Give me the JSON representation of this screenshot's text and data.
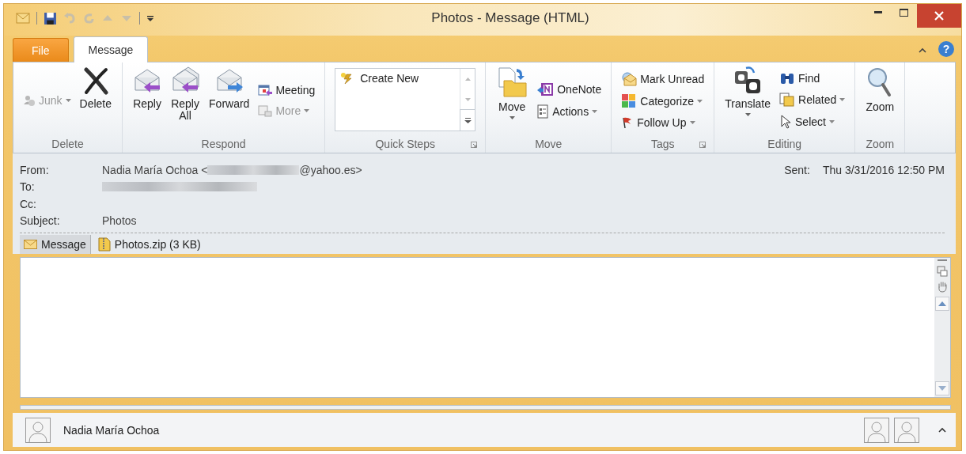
{
  "window": {
    "title": "Photos - Message (HTML)"
  },
  "tabs": [
    {
      "label": "File",
      "selected": false,
      "kind": "file"
    },
    {
      "label": "Message",
      "selected": true,
      "kind": "tab"
    }
  ],
  "help": "?",
  "ribbon_groups": [
    {
      "label": "Delete",
      "items": [
        {
          "kind": "column",
          "buttons": [
            {
              "label": "Junk",
              "disabled": true,
              "dropdown": true
            }
          ]
        },
        {
          "kind": "large",
          "label": "Delete",
          "disabled": false,
          "dropdown": false
        }
      ]
    },
    {
      "label": "Respond",
      "items": [
        {
          "kind": "large",
          "label": "Reply",
          "disabled": false,
          "dropdown": false
        },
        {
          "kind": "large",
          "label": "Reply\nAll",
          "disabled": false,
          "dropdown": false
        },
        {
          "kind": "large",
          "label": "Forward",
          "disabled": false,
          "dropdown": false
        },
        {
          "kind": "column",
          "buttons": [
            {
              "label": "Meeting",
              "disabled": false,
              "dropdown": false
            },
            {
              "label": "More",
              "disabled": true,
              "dropdown": true
            }
          ]
        }
      ]
    },
    {
      "label": "Quick Steps",
      "launcher": true,
      "items": [
        {
          "kind": "gallery",
          "entries": [
            "Create New"
          ]
        }
      ]
    },
    {
      "label": "Move",
      "items": [
        {
          "kind": "large",
          "label": "Move",
          "disabled": false,
          "dropdown": true
        },
        {
          "kind": "column",
          "buttons": [
            {
              "label": "OneNote",
              "disabled": false,
              "dropdown": false
            },
            {
              "label": "Actions",
              "disabled": false,
              "dropdown": true
            }
          ]
        }
      ]
    },
    {
      "label": "Tags",
      "launcher": true,
      "items": [
        {
          "kind": "column",
          "buttons": [
            {
              "label": "Mark Unread",
              "disabled": false,
              "dropdown": false
            },
            {
              "label": "Categorize",
              "disabled": false,
              "dropdown": true
            },
            {
              "label": "Follow Up",
              "disabled": false,
              "dropdown": true
            }
          ]
        }
      ]
    },
    {
      "label": "Editing",
      "items": [
        {
          "kind": "large",
          "label": "Translate",
          "disabled": false,
          "dropdown": true
        },
        {
          "kind": "column",
          "buttons": [
            {
              "label": "Find",
              "disabled": false,
              "dropdown": false
            },
            {
              "label": "Related",
              "disabled": false,
              "dropdown": true
            },
            {
              "label": "Select",
              "disabled": false,
              "dropdown": true
            }
          ]
        }
      ]
    },
    {
      "label": "Zoom",
      "items": [
        {
          "kind": "large",
          "label": "Zoom",
          "disabled": false,
          "dropdown": false
        }
      ]
    }
  ],
  "header": {
    "fields": [
      {
        "label": "From:",
        "parts": [
          {
            "kind": "text",
            "text": "Nadia María Ochoa <"
          },
          {
            "kind": "redacted"
          },
          {
            "kind": "text",
            "text": "@yahoo.es>"
          }
        ]
      },
      {
        "label": "To:",
        "parts": [
          {
            "kind": "redacted"
          }
        ]
      },
      {
        "label": "Cc:"
      },
      {
        "label": "Subject:",
        "parts": [
          {
            "kind": "text",
            "text": "Photos"
          }
        ]
      }
    ],
    "sent": {
      "label": "Sent:",
      "value": "Thu 3/31/2016 12:50 PM"
    }
  },
  "attachments": [
    {
      "label": "Message",
      "selected": true,
      "kind": "message"
    },
    {
      "label": "Photos.zip (3 KB)",
      "selected": false,
      "kind": "file"
    }
  ],
  "people_pane": {
    "name": "Nadia María Ochoa"
  }
}
